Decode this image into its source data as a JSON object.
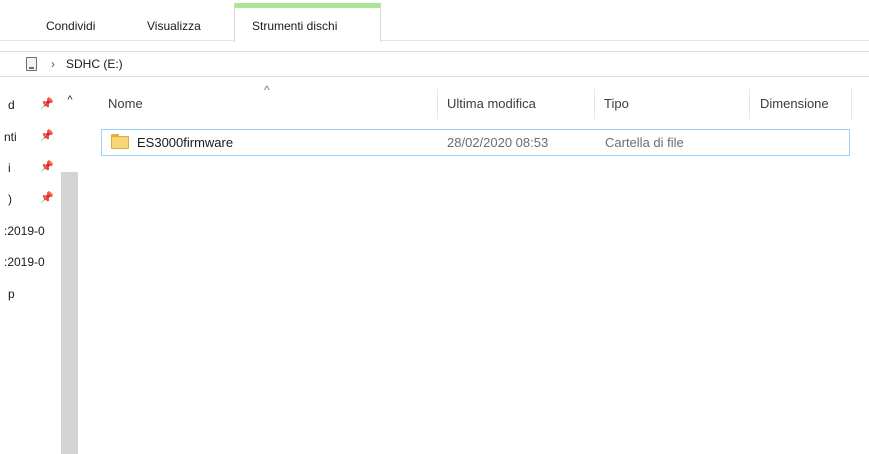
{
  "ribbon": {
    "tabs": [
      {
        "label": "Condividi"
      },
      {
        "label": "Visualizza"
      },
      {
        "label": "Strumenti dischi",
        "active": true
      }
    ]
  },
  "address": {
    "separator": "›",
    "location": "SDHC (E:)",
    "icon": "drive-icon"
  },
  "nav": {
    "scroll_up": "^",
    "items": [
      {
        "label": "d",
        "pinned": true
      },
      {
        "label": "nti",
        "pinned": true
      },
      {
        "label": "i",
        "pinned": true
      },
      {
        "label": ")",
        "pinned": true
      },
      {
        "label": ":2019-0",
        "pinned": false
      },
      {
        "label": ":2019-0",
        "pinned": false
      },
      {
        "label": "p",
        "pinned": false
      }
    ]
  },
  "columns": {
    "name": "Nome",
    "modified": "Ultima modifica",
    "type": "Tipo",
    "size": "Dimensione",
    "sort_indicator": "^"
  },
  "files": [
    {
      "name": "ES3000firmware",
      "modified": "28/02/2020 08:53",
      "type": "Cartella di file",
      "size": "",
      "icon": "folder-icon"
    }
  ],
  "colors": {
    "active_tab_accent": "#a9e59b",
    "row_selection_border": "#99d1ff",
    "folder": "#f7d677"
  }
}
